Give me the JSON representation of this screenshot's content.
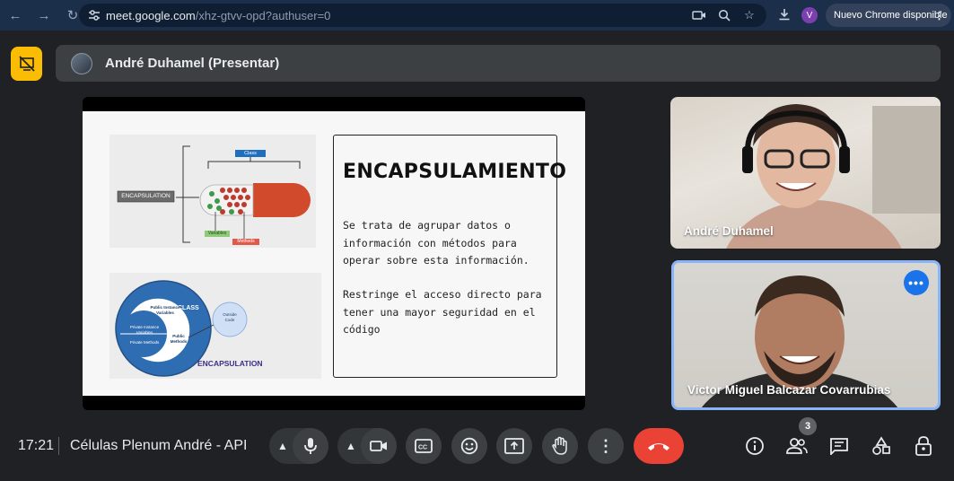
{
  "browser": {
    "url_host": "meet.google.com",
    "url_path": "/xhz-gtvv-opd?authuser=0",
    "profile_initial": "V",
    "update_label": "Nuevo Chrome disponible"
  },
  "presenter": {
    "label": "André Duhamel (Presentar)"
  },
  "slide": {
    "title": "ENCAPSULAMIENTO",
    "paragraph1": "Se trata de agrupar datos o\ninformación con métodos para\noperar sobre esta información.",
    "paragraph2": "Restringe el acceso directo para\ntener una mayor seguridad en el\ncódigo",
    "diagram1": {
      "class_label": "Class",
      "encapsulation_label": "ENCAPSULATION",
      "variables_label": "Variables",
      "methods_label": "Methods"
    },
    "diagram2": {
      "class_label": "CLASS",
      "public_instance_label": "Public Instance Variables",
      "private_instance_label": "Private Instance Variables",
      "private_methods_label": "Private Methods",
      "public_methods_label": "Public Methods",
      "outside_code_label": "Outside Code",
      "encapsulation_label": "ENCAPSULATION"
    }
  },
  "participants": [
    {
      "name": "André Duhamel"
    },
    {
      "name": "Victor Miguel Balcazar Covarrubias"
    }
  ],
  "bottom_bar": {
    "time": "17:21",
    "meeting_name": "Células Plenum André - API",
    "participant_count": "3"
  },
  "colors": {
    "present_icon": "#fbbc04",
    "end_call": "#ea4335",
    "active_speaker": "#8ab4f8"
  }
}
